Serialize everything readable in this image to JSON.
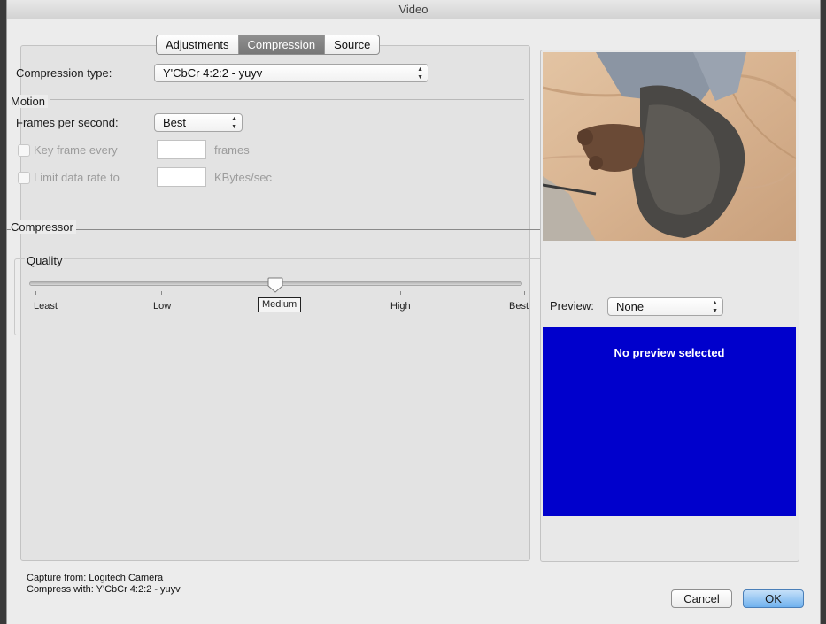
{
  "window": {
    "title": "Video"
  },
  "tabs": [
    {
      "label": "Adjustments",
      "active": false
    },
    {
      "label": "Compression",
      "active": true
    },
    {
      "label": "Source",
      "active": false
    }
  ],
  "compression": {
    "type_label": "Compression type:",
    "type_value": "Y'CbCr 4:2:2 - yuyv"
  },
  "motion": {
    "section_label": "Motion",
    "fps_label": "Frames per second:",
    "fps_value": "Best",
    "keyframe_label": "Key frame every",
    "keyframe_value": "",
    "keyframe_unit": "frames",
    "limit_label": "Limit data rate to",
    "limit_value": "",
    "limit_unit": "KBytes/sec"
  },
  "compressor": {
    "section_label": "Compressor",
    "quality_label": "Quality",
    "quality_ticks": [
      "Least",
      "Low",
      "Medium",
      "High",
      "Best"
    ],
    "quality_selected": "Medium",
    "quality_position": 0.5
  },
  "preview": {
    "label": "Preview:",
    "value": "None",
    "message": "No preview selected",
    "color": "#0000cc"
  },
  "footer": {
    "capture": "Capture from: Logitech Camera",
    "compress": "Compress with: Y'CbCr 4:2:2 - yuyv"
  },
  "buttons": {
    "cancel": "Cancel",
    "ok": "OK"
  },
  "icons": {
    "select_arrows": "up-down-arrows-icon"
  }
}
